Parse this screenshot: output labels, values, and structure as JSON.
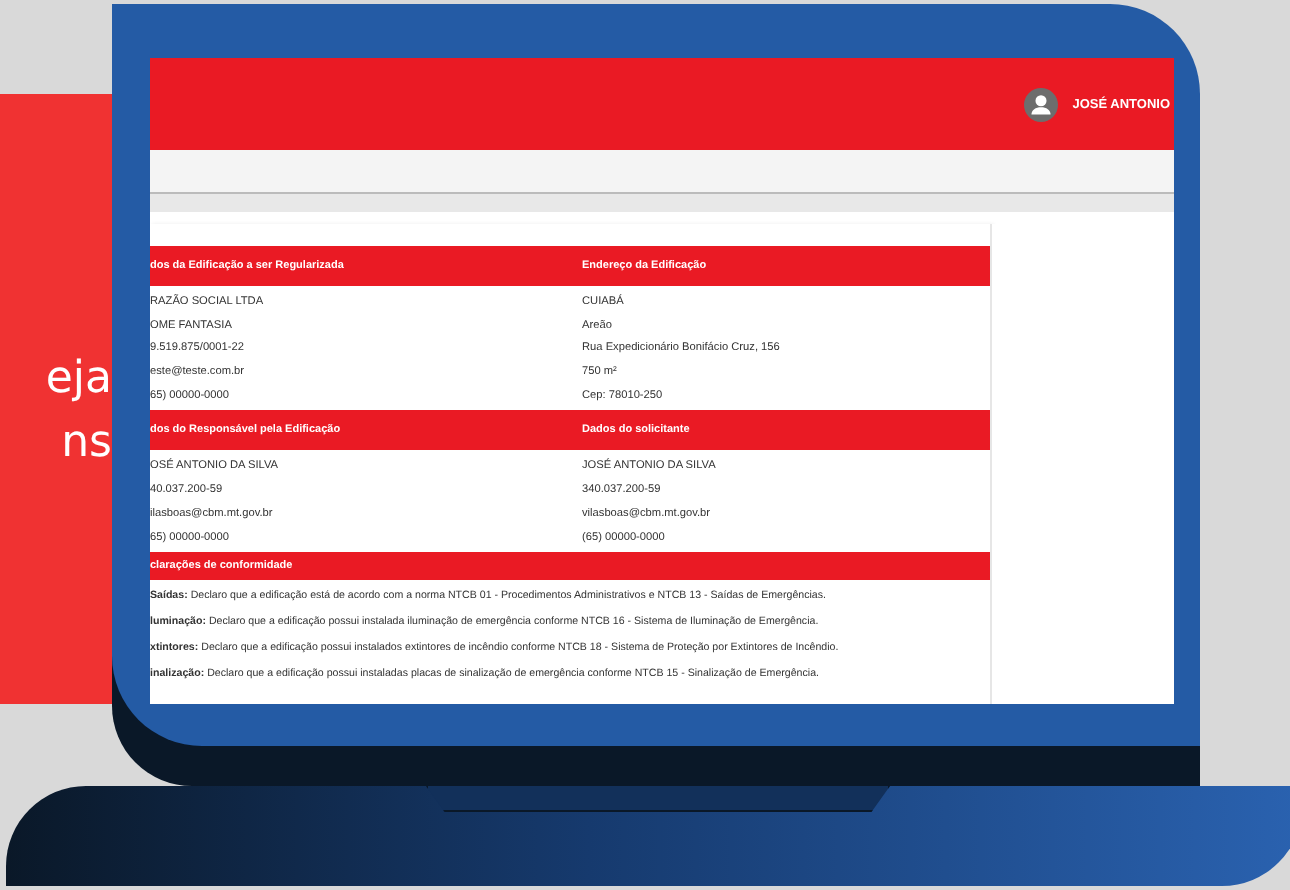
{
  "side_banner": {
    "lines": [
      "eja",
      "ns"
    ]
  },
  "header": {
    "user_name": "JOSÉ ANTONIO"
  },
  "sections": [
    {
      "title": "dos da Edificação a ser Regularizada",
      "rows": [
        "RAZÃO SOCIAL LTDA",
        "OME FANTASIA",
        "9.519.875/0001-22",
        "este@teste.com.br",
        "65) 00000-0000"
      ]
    },
    {
      "title": "Endereço da Edificação",
      "rows": [
        "CUIABÁ",
        "Areão",
        "Rua Expedicionário Bonifácio Cruz, 156",
        "750 m²",
        "Cep: 78010-250"
      ]
    },
    {
      "title": "dos do Responsável pela Edificação",
      "rows": [
        "OSÉ ANTONIO DA SILVA",
        "40.037.200-59",
        "ilasboas@cbm.mt.gov.br",
        "65) 00000-0000"
      ]
    },
    {
      "title": "Dados do solicitante",
      "rows": [
        "JOSÉ ANTONIO DA SILVA",
        "340.037.200-59",
        "vilasboas@cbm.mt.gov.br",
        "(65) 00000-0000"
      ]
    }
  ],
  "declarations": {
    "title": "clarações de conformidade",
    "items": [
      "**Saídas:** Declaro que a edificação está de acordo com a norma NTCB 01 - Procedimentos Administrativos e NTCB 13 - Saídas de Emergências.",
      "**luminação:** Declaro que a edificação possui instalada iluminação de emergência conforme NTCB 16 - Sistema de Iluminação de Emergência.",
      "**xtintores:** Declaro que a edificação possui instalados extintores de incêndio conforme NTCB 18 - Sistema de Proteção por Extintores de Incêndio.",
      "**inalização:** Declaro que a edificação possui instaladas placas de sinalização de emergência conforme NTCB 15 - Sinalização de Emergência."
    ]
  }
}
